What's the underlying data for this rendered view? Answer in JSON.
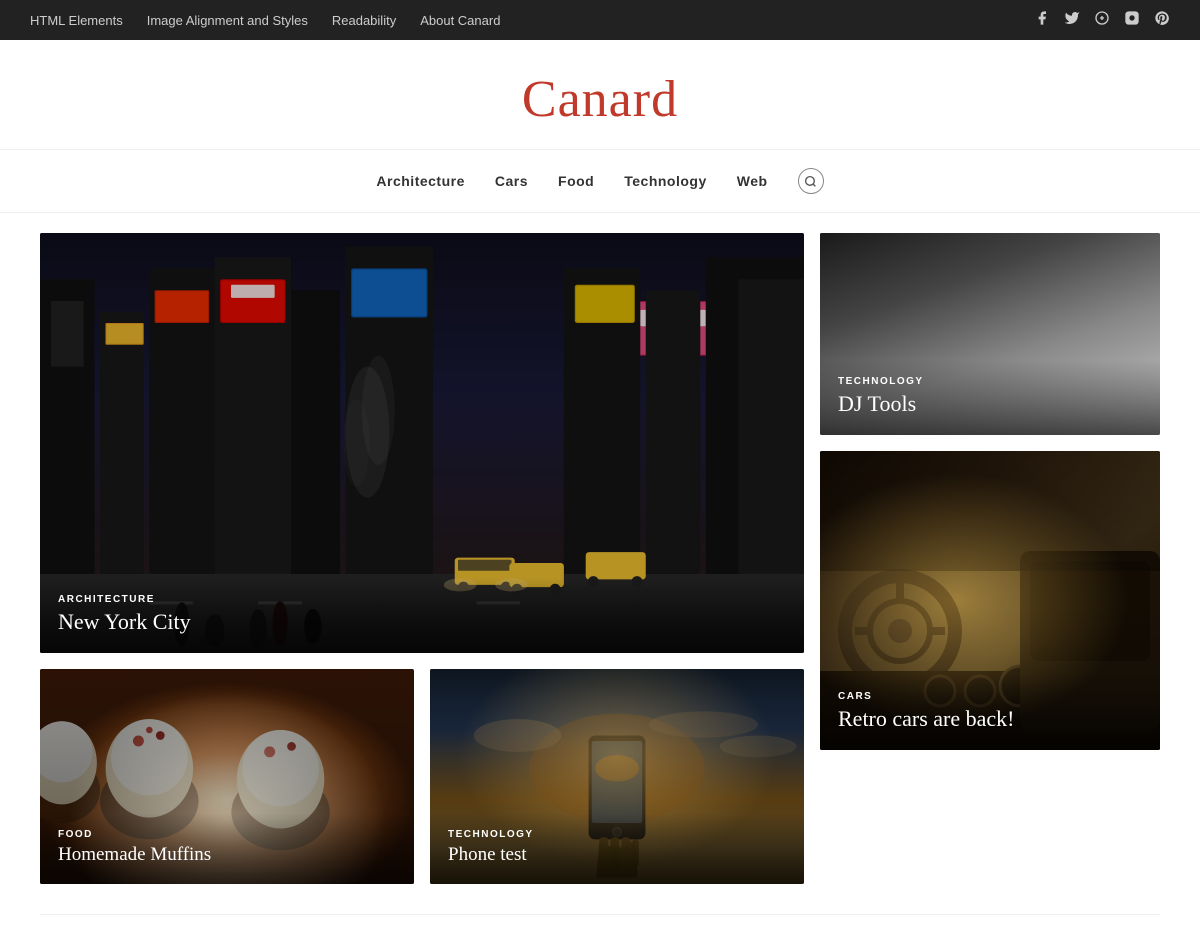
{
  "topnav": {
    "links": [
      {
        "label": "HTML Elements",
        "id": "html-elements"
      },
      {
        "label": "Image Alignment and Styles",
        "id": "image-alignment"
      },
      {
        "label": "Readability",
        "id": "readability"
      },
      {
        "label": "About Canard",
        "id": "about-canard"
      }
    ],
    "social": [
      {
        "icon": "f",
        "name": "facebook-icon"
      },
      {
        "icon": "t",
        "name": "twitter-icon"
      },
      {
        "icon": "g+",
        "name": "googleplus-icon"
      },
      {
        "icon": "📷",
        "name": "instagram-icon"
      },
      {
        "icon": "p",
        "name": "pinterest-icon"
      }
    ]
  },
  "site": {
    "title": "Canard"
  },
  "mainnav": {
    "links": [
      {
        "label": "Architecture"
      },
      {
        "label": "Cars"
      },
      {
        "label": "Food"
      },
      {
        "label": "Technology"
      },
      {
        "label": "Web"
      }
    ],
    "search_label": "🔍"
  },
  "cards": {
    "featured": {
      "category": "ARCHITECTURE",
      "title": "New York City"
    },
    "side1": {
      "category": "TECHNOLOGY",
      "title": "DJ Tools"
    },
    "side2": {
      "category": "CARS",
      "title": "Retro cars are back!"
    },
    "bottom1": {
      "category": "FOOD",
      "title": "Homemade Muffins"
    },
    "bottom2": {
      "category": "TECHNOLOGY",
      "title": "Phone test"
    }
  }
}
